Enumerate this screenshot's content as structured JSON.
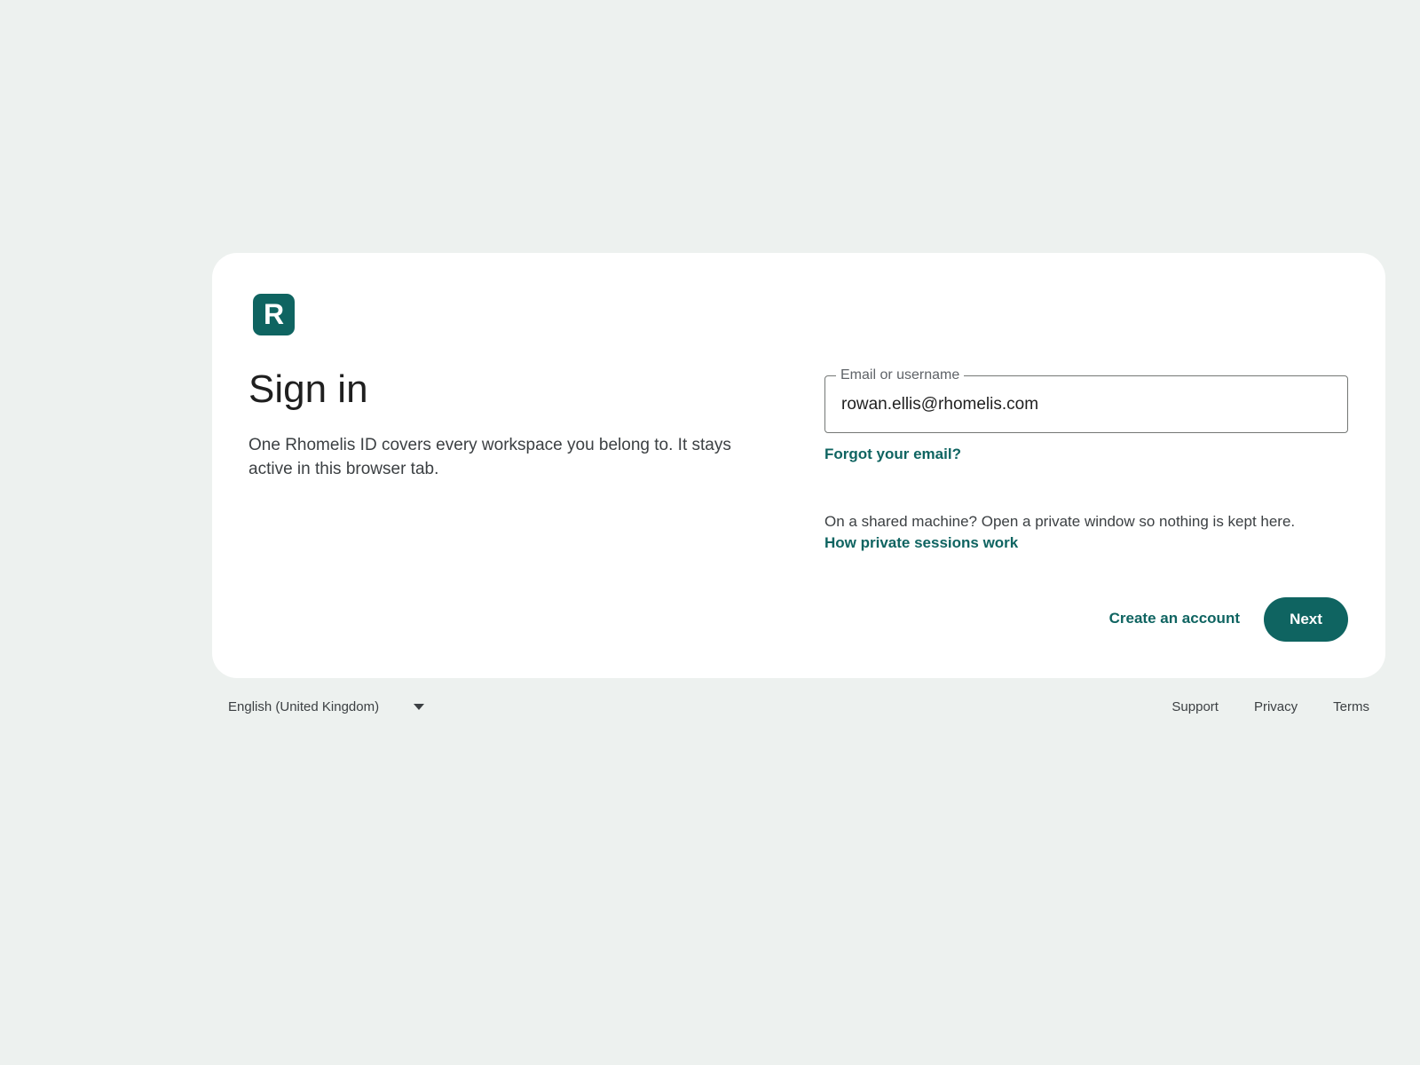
{
  "brand": {
    "logo_letter": "R",
    "color": "#0f6461"
  },
  "signin": {
    "title": "Sign in",
    "description": "One Rhomelis ID covers every workspace you belong to. It stays active in this browser tab.",
    "email_field": {
      "label": "Email or username",
      "value": "rowan.ellis@rhomelis.com"
    },
    "forgot_link": "Forgot your email?",
    "shared_notice": "On a shared machine? Open a private window so nothing is kept here.",
    "private_link": "How private sessions work",
    "create_account": "Create an account",
    "next_label": "Next"
  },
  "footer": {
    "language": "English (United Kingdom)",
    "links": [
      "Support",
      "Privacy",
      "Terms"
    ]
  }
}
